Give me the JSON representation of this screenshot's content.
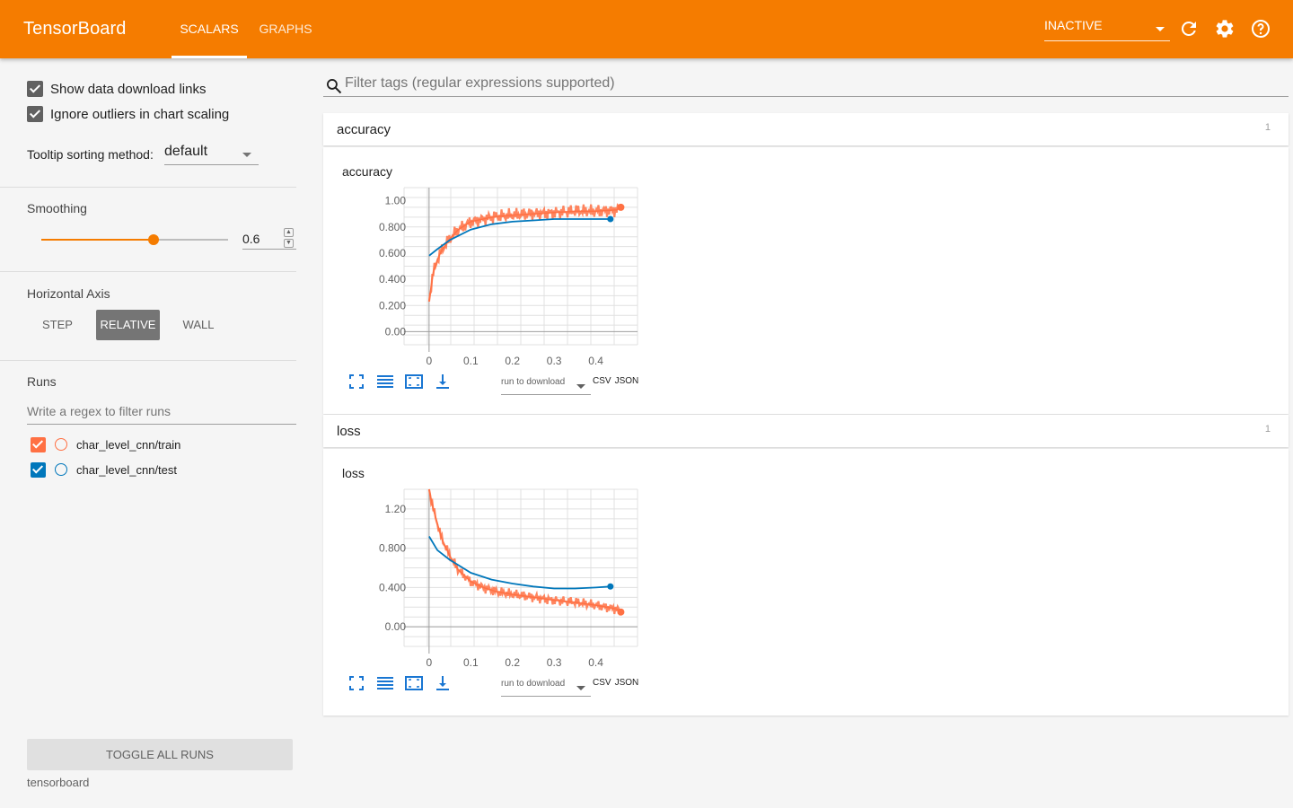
{
  "app": {
    "title": "TensorBoard",
    "tabs": [
      {
        "label": "SCALARS"
      },
      {
        "label": "GRAPHS"
      }
    ],
    "status": "INACTIVE"
  },
  "colors": {
    "header": "#f57c00",
    "train": "#ff7043",
    "test": "#0077bb",
    "accent": "#f57c00"
  },
  "sidebar": {
    "show_download": "Show data download links",
    "ignore_outliers": "Ignore outliers in chart scaling",
    "tooltip_label": "Tooltip sorting method:",
    "tooltip_value": "default",
    "smoothing_title": "Smoothing",
    "smoothing_value": "0.6",
    "smoothing_fraction": 0.6,
    "horizontal_axis_title": "Horizontal Axis",
    "axis_options": [
      {
        "label": "STEP"
      },
      {
        "label": "RELATIVE"
      },
      {
        "label": "WALL"
      }
    ],
    "axis_selected": "RELATIVE",
    "runs_title": "Runs",
    "runs_filter_placeholder": "Write a regex to filter runs",
    "runs": [
      {
        "name": "char_level_cnn/train"
      },
      {
        "name": "char_level_cnn/test"
      }
    ],
    "toggle_all": "TOGGLE ALL RUNS",
    "footer": "tensorboard"
  },
  "main": {
    "filter_placeholder": "Filter tags (regular expressions supported)",
    "categories": [
      {
        "name": "accuracy",
        "count": "1"
      },
      {
        "name": "loss",
        "count": "1"
      }
    ],
    "download_select": "run to download",
    "csv": "CSV",
    "json": "JSON"
  },
  "chart_data": [
    {
      "type": "line",
      "title": "accuracy",
      "xlabel": "",
      "ylabel": "",
      "x_ticks": [
        "0",
        "0.1",
        "0.2",
        "0.3",
        "0.4"
      ],
      "y_ticks": [
        "0.00",
        "0.200",
        "0.400",
        "0.600",
        "0.800",
        "1.00"
      ],
      "xlim": [
        -0.06,
        0.5
      ],
      "ylim": [
        -0.1,
        1.1
      ],
      "grid": true,
      "series": [
        {
          "name": "char_level_cnn/train",
          "x": [
            0,
            0.005,
            0.01,
            0.02,
            0.03,
            0.05,
            0.07,
            0.1,
            0.13,
            0.16,
            0.2,
            0.25,
            0.3,
            0.35,
            0.4,
            0.45,
            0.46
          ],
          "y": [
            0.23,
            0.35,
            0.45,
            0.55,
            0.62,
            0.71,
            0.78,
            0.84,
            0.86,
            0.88,
            0.89,
            0.9,
            0.91,
            0.92,
            0.92,
            0.93,
            0.95
          ]
        },
        {
          "name": "char_level_cnn/test",
          "x": [
            0,
            0.02,
            0.05,
            0.1,
            0.15,
            0.2,
            0.25,
            0.3,
            0.35,
            0.4,
            0.435
          ],
          "y": [
            0.58,
            0.63,
            0.7,
            0.78,
            0.82,
            0.84,
            0.85,
            0.86,
            0.86,
            0.86,
            0.86
          ]
        }
      ]
    },
    {
      "type": "line",
      "title": "loss",
      "xlabel": "",
      "ylabel": "",
      "x_ticks": [
        "0",
        "0.1",
        "0.2",
        "0.3",
        "0.4"
      ],
      "y_ticks": [
        "0.00",
        "0.400",
        "0.800",
        "1.20"
      ],
      "xlim": [
        -0.06,
        0.5
      ],
      "ylim": [
        -0.2,
        1.4
      ],
      "grid": true,
      "series": [
        {
          "name": "char_level_cnn/train",
          "x": [
            0,
            0.005,
            0.01,
            0.02,
            0.03,
            0.05,
            0.07,
            0.1,
            0.13,
            0.16,
            0.2,
            0.25,
            0.3,
            0.35,
            0.4,
            0.45,
            0.46
          ],
          "y": [
            1.4,
            1.3,
            1.2,
            1.05,
            0.9,
            0.72,
            0.58,
            0.46,
            0.4,
            0.36,
            0.33,
            0.3,
            0.27,
            0.25,
            0.22,
            0.18,
            0.15
          ]
        },
        {
          "name": "char_level_cnn/test",
          "x": [
            0,
            0.02,
            0.05,
            0.1,
            0.15,
            0.2,
            0.25,
            0.3,
            0.35,
            0.4,
            0.435
          ],
          "y": [
            0.92,
            0.78,
            0.68,
            0.55,
            0.48,
            0.44,
            0.41,
            0.39,
            0.39,
            0.4,
            0.41
          ]
        }
      ]
    }
  ]
}
